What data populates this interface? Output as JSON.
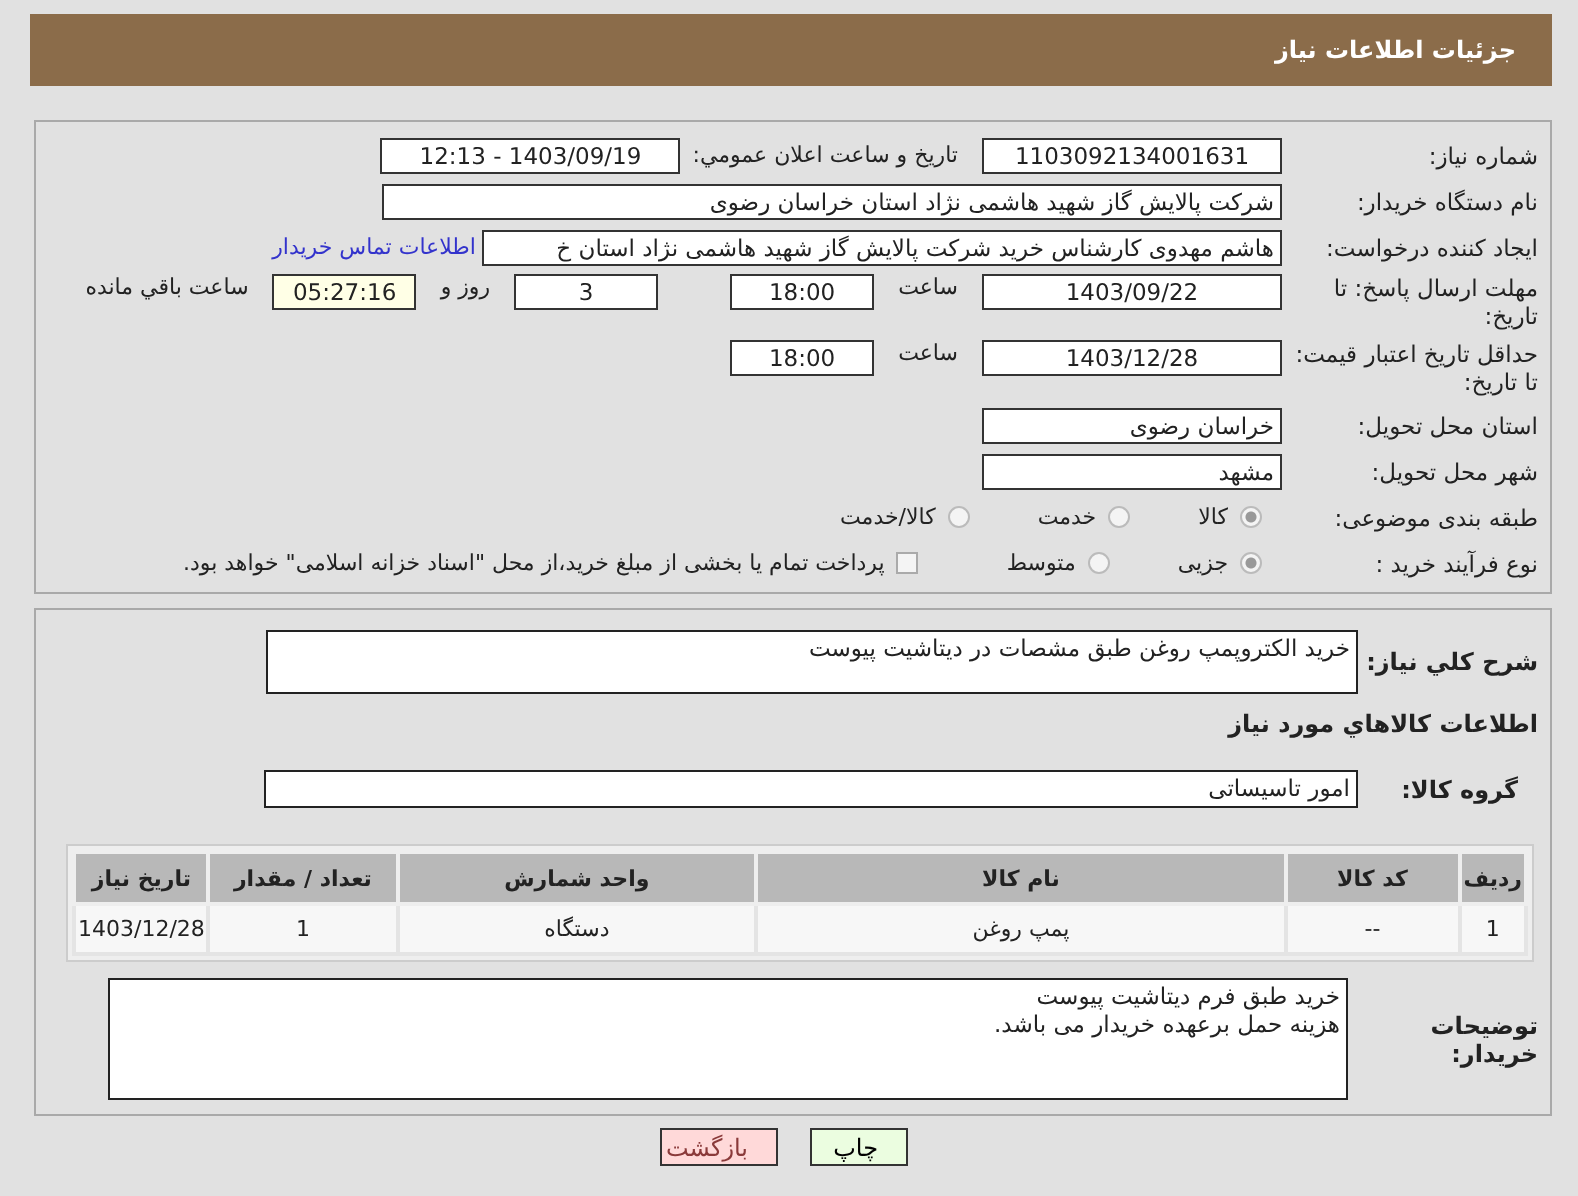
{
  "header": {
    "title": "جزئیات اطلاعات نیاز"
  },
  "need_number": {
    "label": "شماره نیاز:",
    "value": "1103092134001631"
  },
  "announce": {
    "label": "تاریخ و ساعت اعلان عمومي:",
    "value": "1403/09/19 - 12:13"
  },
  "buyer_org": {
    "label": "نام دستگاه خریدار:",
    "value": "شرکت پالایش گاز شهید هاشمی نژاد   استان خراسان رضوی"
  },
  "creator": {
    "label": "ایجاد کننده درخواست:",
    "value": "هاشم مهدوی کارشناس خرید شرکت پالایش گاز شهید هاشمی نژاد   استان خ",
    "link": "اطلاعات تماس خریدار"
  },
  "deadline": {
    "label": "مهلت ارسال پاسخ: تا تاریخ:",
    "date": "1403/09/22",
    "time_label": "ساعت",
    "time": "18:00",
    "days": "3",
    "days_label": "روز و",
    "remaining": "05:27:16",
    "remaining_label": "ساعت باقي مانده"
  },
  "validity": {
    "label": "حداقل تاریخ اعتبار قیمت: تا تاریخ:",
    "date": "1403/12/28",
    "time_label": "ساعت",
    "time": "18:00"
  },
  "province": {
    "label": "استان محل تحویل:",
    "value": "خراسان رضوی"
  },
  "city": {
    "label": "شهر محل تحویل:",
    "value": "مشهد"
  },
  "category": {
    "label": "طبقه بندی موضوعی:",
    "options": [
      {
        "label": "کالا",
        "selected": true
      },
      {
        "label": "خدمت",
        "selected": false
      },
      {
        "label": "کالا/خدمت",
        "selected": false
      }
    ]
  },
  "process": {
    "label": "نوع فرآیند خرید :",
    "options": [
      {
        "label": "جزیی",
        "selected": true
      },
      {
        "label": "متوسط",
        "selected": false
      }
    ],
    "treasury": {
      "label": "پرداخت تمام یا بخشی از مبلغ خرید،از محل \"اسناد خزانه اسلامی\" خواهد بود.",
      "checked": false
    }
  },
  "description": {
    "label": "شرح کلي نیاز:",
    "value": "خرید الکتروپمپ روغن طبق مشصات در دیتاشیت پیوست"
  },
  "goods_heading": "اطلاعات کالاهاي مورد نیاز",
  "goods_group": {
    "label": "گروه کالا:",
    "value": "امور تاسیساتی"
  },
  "table": {
    "columns": [
      "ردیف",
      "کد کالا",
      "نام کالا",
      "واحد شمارش",
      "تعداد / مقدار",
      "تاریخ نیاز"
    ],
    "rows": [
      [
        "1",
        "--",
        "پمپ روغن",
        "دستگاه",
        "1",
        "1403/12/28"
      ]
    ]
  },
  "buyer_notes": {
    "label": "توضیحات خریدار:",
    "lines": [
      "خرید طبق فرم دیتاشیت پیوست",
      "هزینه حمل برعهده خریدار می باشد."
    ]
  },
  "buttons": [
    {
      "label": "چاپ",
      "kind": "print"
    },
    {
      "label": "بازگشت",
      "kind": "back"
    }
  ]
}
